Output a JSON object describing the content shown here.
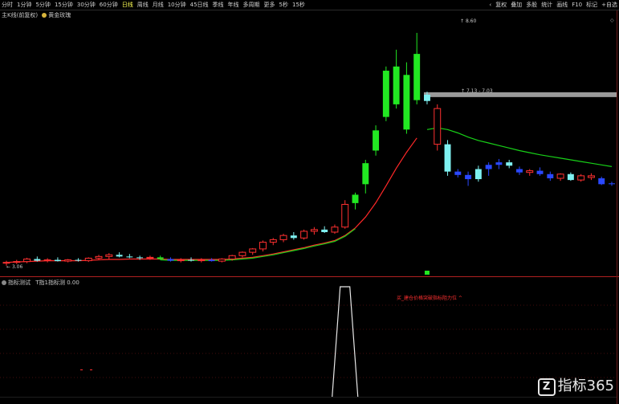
{
  "toolbar": {
    "period_tabs": [
      "分时",
      "1分钟",
      "5分钟",
      "15分钟",
      "30分钟",
      "60分钟",
      "日线",
      "周线",
      "月线",
      "10分钟",
      "45日线",
      "季线",
      "年线",
      "多周期",
      "更多"
    ],
    "period_codes": [
      "5秒",
      "15秒"
    ],
    "active_tab": "日线",
    "right_items": [
      "复权",
      "叠加",
      "多股",
      "统计",
      "画线",
      "F10",
      "标记",
      "+自选"
    ],
    "right_icon": "chevron-left-icon"
  },
  "main_chart": {
    "title": "主K线(前复权)",
    "indicator_name": "黄金玫瑰",
    "high_label": "8.60",
    "low_label": "3.06",
    "price_range_label": "7.13 - 7.03",
    "corner_icon": "diamond-icon"
  },
  "sub_chart": {
    "title": "指标测试",
    "indicator_label": "T指1指标测",
    "value_label": "0.00",
    "signal_text": "买_建仓价格突破指标阻力位 ^"
  },
  "watermark": {
    "brand": "指标365",
    "logo_letter": "Z"
  },
  "colors": {
    "up": "#ff3030",
    "down_green": "#22e822",
    "down_cyan": "#7ef0f0",
    "blue": "#2a48ff",
    "ma_red": "#ff2828",
    "ma_green": "#18d018",
    "grid_red": "#8a1a1a"
  },
  "chart_data": {
    "type": "candlestick",
    "ylim": [
      3.0,
      9.0
    ],
    "candles": [
      {
        "o": 3.12,
        "h": 3.18,
        "l": 3.06,
        "c": 3.14,
        "col": "up"
      },
      {
        "o": 3.14,
        "h": 3.2,
        "l": 3.1,
        "c": 3.16,
        "col": "up"
      },
      {
        "o": 3.16,
        "h": 3.25,
        "l": 3.12,
        "c": 3.22,
        "col": "up"
      },
      {
        "o": 3.22,
        "h": 3.28,
        "l": 3.16,
        "c": 3.18,
        "col": "down_cyan"
      },
      {
        "o": 3.18,
        "h": 3.24,
        "l": 3.14,
        "c": 3.2,
        "col": "up"
      },
      {
        "o": 3.2,
        "h": 3.26,
        "l": 3.16,
        "c": 3.17,
        "col": "down_cyan"
      },
      {
        "o": 3.17,
        "h": 3.22,
        "l": 3.14,
        "c": 3.2,
        "col": "up"
      },
      {
        "o": 3.2,
        "h": 3.24,
        "l": 3.16,
        "c": 3.18,
        "col": "down_cyan"
      },
      {
        "o": 3.18,
        "h": 3.26,
        "l": 3.15,
        "c": 3.24,
        "col": "up"
      },
      {
        "o": 3.24,
        "h": 3.32,
        "l": 3.2,
        "c": 3.28,
        "col": "up"
      },
      {
        "o": 3.28,
        "h": 3.36,
        "l": 3.22,
        "c": 3.32,
        "col": "up"
      },
      {
        "o": 3.32,
        "h": 3.38,
        "l": 3.26,
        "c": 3.28,
        "col": "down_cyan"
      },
      {
        "o": 3.28,
        "h": 3.34,
        "l": 3.24,
        "c": 3.26,
        "col": "down_cyan"
      },
      {
        "o": 3.26,
        "h": 3.3,
        "l": 3.2,
        "c": 3.24,
        "col": "down_cyan"
      },
      {
        "o": 3.24,
        "h": 3.3,
        "l": 3.2,
        "c": 3.26,
        "col": "up"
      },
      {
        "o": 3.26,
        "h": 3.3,
        "l": 3.2,
        "c": 3.22,
        "col": "down_green"
      },
      {
        "o": 3.22,
        "h": 3.26,
        "l": 3.16,
        "c": 3.18,
        "col": "blue"
      },
      {
        "o": 3.18,
        "h": 3.24,
        "l": 3.14,
        "c": 3.2,
        "col": "up"
      },
      {
        "o": 3.2,
        "h": 3.26,
        "l": 3.16,
        "c": 3.18,
        "col": "down_cyan"
      },
      {
        "o": 3.18,
        "h": 3.24,
        "l": 3.14,
        "c": 3.2,
        "col": "up"
      },
      {
        "o": 3.2,
        "h": 3.24,
        "l": 3.16,
        "c": 3.17,
        "col": "blue"
      },
      {
        "o": 3.17,
        "h": 3.24,
        "l": 3.14,
        "c": 3.22,
        "col": "up"
      },
      {
        "o": 3.22,
        "h": 3.32,
        "l": 3.18,
        "c": 3.3,
        "col": "up"
      },
      {
        "o": 3.3,
        "h": 3.4,
        "l": 3.26,
        "c": 3.38,
        "col": "up"
      },
      {
        "o": 3.38,
        "h": 3.48,
        "l": 3.32,
        "c": 3.46,
        "col": "up"
      },
      {
        "o": 3.46,
        "h": 3.66,
        "l": 3.4,
        "c": 3.62,
        "col": "up"
      },
      {
        "o": 3.62,
        "h": 3.72,
        "l": 3.55,
        "c": 3.68,
        "col": "up"
      },
      {
        "o": 3.68,
        "h": 3.82,
        "l": 3.62,
        "c": 3.78,
        "col": "up"
      },
      {
        "o": 3.78,
        "h": 3.86,
        "l": 3.68,
        "c": 3.72,
        "col": "down_cyan"
      },
      {
        "o": 3.72,
        "h": 3.92,
        "l": 3.68,
        "c": 3.88,
        "col": "up"
      },
      {
        "o": 3.88,
        "h": 3.98,
        "l": 3.8,
        "c": 3.92,
        "col": "up"
      },
      {
        "o": 3.92,
        "h": 4.0,
        "l": 3.84,
        "c": 3.86,
        "col": "down_cyan"
      },
      {
        "o": 3.86,
        "h": 4.04,
        "l": 3.82,
        "c": 3.98,
        "col": "up"
      },
      {
        "o": 3.98,
        "h": 4.62,
        "l": 3.94,
        "c": 4.52,
        "col": "up"
      },
      {
        "o": 4.55,
        "h": 4.8,
        "l": 4.4,
        "c": 4.75,
        "col": "down_green"
      },
      {
        "o": 5.0,
        "h": 5.58,
        "l": 4.78,
        "c": 5.5,
        "col": "down_green"
      },
      {
        "o": 5.8,
        "h": 6.4,
        "l": 5.68,
        "c": 6.28,
        "col": "down_green"
      },
      {
        "o": 6.6,
        "h": 7.8,
        "l": 6.5,
        "c": 7.7,
        "col": "down_green"
      },
      {
        "o": 6.9,
        "h": 8.2,
        "l": 6.8,
        "c": 7.8,
        "col": "down_green"
      },
      {
        "o": 6.3,
        "h": 7.9,
        "l": 6.2,
        "c": 7.6,
        "col": "down_green"
      },
      {
        "o": 7.0,
        "h": 8.6,
        "l": 6.9,
        "c": 8.1,
        "col": "down_green"
      },
      {
        "o": 7.13,
        "h": 7.2,
        "l": 6.9,
        "c": 6.98,
        "col": "down_cyan"
      },
      {
        "o": 6.8,
        "h": 6.9,
        "l": 5.8,
        "c": 5.95,
        "col": "up_small"
      },
      {
        "o": 5.95,
        "h": 6.05,
        "l": 5.2,
        "c": 5.3,
        "col": "down_cyan"
      },
      {
        "o": 5.3,
        "h": 5.36,
        "l": 5.16,
        "c": 5.22,
        "col": "blue"
      },
      {
        "o": 5.22,
        "h": 5.3,
        "l": 4.96,
        "c": 5.12,
        "col": "blue"
      },
      {
        "o": 5.12,
        "h": 5.44,
        "l": 5.06,
        "c": 5.36,
        "col": "down_cyan"
      },
      {
        "o": 5.36,
        "h": 5.52,
        "l": 5.2,
        "c": 5.46,
        "col": "blue"
      },
      {
        "o": 5.46,
        "h": 5.6,
        "l": 5.36,
        "c": 5.52,
        "col": "blue"
      },
      {
        "o": 5.52,
        "h": 5.58,
        "l": 5.38,
        "c": 5.44,
        "col": "down_cyan"
      },
      {
        "o": 5.36,
        "h": 5.42,
        "l": 5.22,
        "c": 5.28,
        "col": "blue"
      },
      {
        "o": 5.28,
        "h": 5.36,
        "l": 5.2,
        "c": 5.32,
        "col": "up"
      },
      {
        "o": 5.32,
        "h": 5.4,
        "l": 5.2,
        "c": 5.24,
        "col": "blue"
      },
      {
        "o": 5.24,
        "h": 5.3,
        "l": 5.08,
        "c": 5.14,
        "col": "blue"
      },
      {
        "o": 5.14,
        "h": 5.26,
        "l": 5.08,
        "c": 5.24,
        "col": "up"
      },
      {
        "o": 5.24,
        "h": 5.28,
        "l": 5.08,
        "c": 5.1,
        "col": "down_cyan"
      },
      {
        "o": 5.1,
        "h": 5.24,
        "l": 5.06,
        "c": 5.2,
        "col": "up"
      },
      {
        "o": 5.2,
        "h": 5.26,
        "l": 5.1,
        "c": 5.16,
        "col": "up"
      },
      {
        "o": 5.14,
        "h": 5.18,
        "l": 4.98,
        "c": 5.0,
        "col": "blue"
      },
      {
        "o": 5.0,
        "h": 5.06,
        "l": 4.96,
        "c": 5.02,
        "col": "blue"
      }
    ],
    "ma_red": [
      3.14,
      3.15,
      3.16,
      3.17,
      3.18,
      3.18,
      3.18,
      3.18,
      3.19,
      3.2,
      3.21,
      3.21,
      3.22,
      3.22,
      3.22,
      3.22,
      3.21,
      3.21,
      3.21,
      3.21,
      3.21,
      3.21,
      3.22,
      3.24,
      3.26,
      3.3,
      3.34,
      3.39,
      3.44,
      3.49,
      3.55,
      3.6,
      3.66,
      3.78,
      3.96,
      4.22,
      4.56,
      4.96,
      5.38,
      5.76,
      6.1,
      6.3,
      6.34,
      6.3,
      6.22,
      6.12,
      6.04,
      5.98,
      5.92,
      5.86,
      5.8,
      5.75,
      5.7,
      5.66,
      5.62,
      5.58,
      5.54,
      5.5,
      5.46,
      5.42
    ],
    "ma_green": [
      3.14,
      3.15,
      3.16,
      3.16,
      3.17,
      3.17,
      3.18,
      3.18,
      3.18,
      3.18,
      3.19,
      3.19,
      3.19,
      3.19,
      3.19,
      3.19,
      3.19,
      3.18,
      3.18,
      3.18,
      3.18,
      3.18,
      3.18,
      3.18,
      3.18,
      3.18,
      3.18,
      3.18,
      3.18,
      3.18,
      3.18,
      3.18,
      3.18,
      3.18,
      3.18,
      3.18,
      3.18,
      3.18,
      3.18,
      3.18,
      3.18,
      3.18,
      6.34,
      6.3,
      6.22,
      6.12,
      6.04,
      5.98,
      5.92,
      5.86,
      5.8,
      5.75,
      5.7,
      5.66,
      5.62,
      5.58,
      5.54,
      5.5,
      5.46,
      5.42
    ],
    "green_segments": [
      [
        15,
        34
      ],
      [
        41,
        59
      ]
    ],
    "price_line": {
      "from_index": 41,
      "value": 7.13
    },
    "signal_index": 33,
    "signal_value": 1
  }
}
